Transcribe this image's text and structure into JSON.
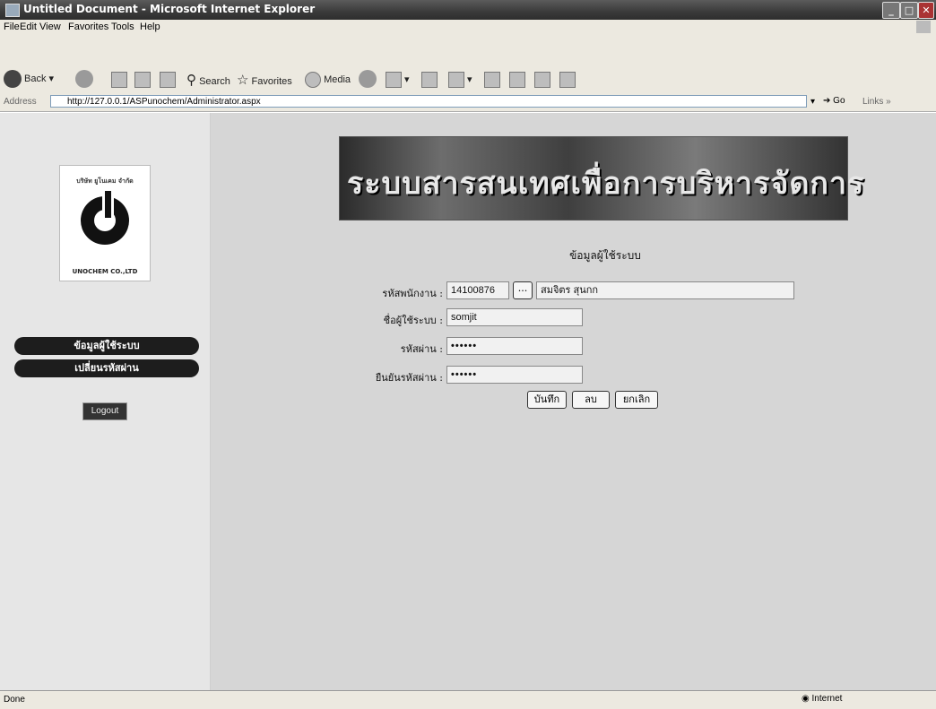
{
  "window": {
    "title": "Untitled Document - Microsoft Internet Explorer"
  },
  "menu": [
    "File",
    "Edit",
    "View",
    "Favorites",
    "Tools",
    "Help"
  ],
  "toolbar": {
    "back": "Back",
    "search": "Search",
    "favorites": "Favorites",
    "media": "Media"
  },
  "address": {
    "label": "Address",
    "url": "http://127.0.0.1/ASPunochem/Administrator.aspx",
    "go": "Go",
    "links": "Links"
  },
  "logo": {
    "top_text": "บริษัท ยูโนเคม จำกัด",
    "bottom_text": "UNOCHEM CO.,LTD"
  },
  "sidebar": {
    "items": [
      "ข้อมูลผู้ใช้ระบบ",
      "เปลี่ยนรหัสผ่าน"
    ],
    "logout": "Logout"
  },
  "banner": {
    "title": "ระบบสารสนเทศเพื่อการบริหารจัดการ"
  },
  "form": {
    "heading": "ข้อมูลผู้ใช้ระบบ",
    "emp_id_label": "รหัสพนักงาน :",
    "emp_id_value": "14100876",
    "lookup_button": "...",
    "emp_name_value": "สมจิตร สุนกก",
    "username_label": "ชื่อผู้ใช้ระบบ :",
    "username_value": "somjit",
    "password_label": "รหัสผ่าน :",
    "password_value": "••••••",
    "confirm_label": "ยืนยันรหัสผ่าน :",
    "confirm_value": "••••••",
    "save": "บันทึก",
    "delete": "ลบ",
    "cancel": "ยกเลิก"
  },
  "status": {
    "left": "Done",
    "zone": "Internet"
  }
}
